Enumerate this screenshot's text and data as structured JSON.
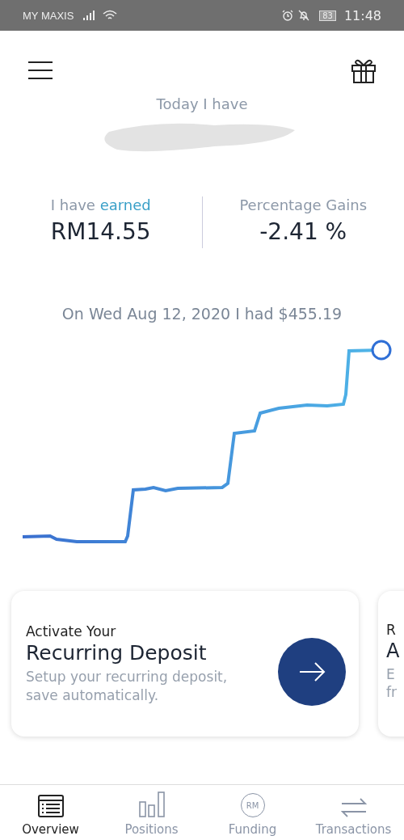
{
  "status_bar": {
    "carrier": "MY MAXIS",
    "battery": "83",
    "time": "11:48"
  },
  "header": {
    "label": "Today I have"
  },
  "stats": [
    {
      "kind": "earned",
      "text": "I have **earned**",
      "value": "RM14.55"
    },
    {
      "kind": "plain",
      "text": "Percentage Gains",
      "value": "-2.41 %"
    }
  ],
  "chart_caption": "On Wed Aug 12, 2020 I had $455.19",
  "cards": [
    {
      "eyebrow": "Activate Your",
      "title": "Recurring Deposit",
      "body": "Setup your recurring deposit, save automatically."
    }
  ],
  "peek_card": {
    "eyebrow": "R",
    "title": "A",
    "body": [
      "E",
      "fr"
    ]
  },
  "nav": [
    {
      "label": "Overview",
      "kind": "list",
      "selected": true
    },
    {
      "label": "Positions",
      "kind": "bars",
      "selected": false
    },
    {
      "label": "Funding",
      "kind": "coin",
      "icon_text": "RM",
      "selected": false
    },
    {
      "label": "Transactions",
      "kind": "swap",
      "selected": false
    }
  ]
}
